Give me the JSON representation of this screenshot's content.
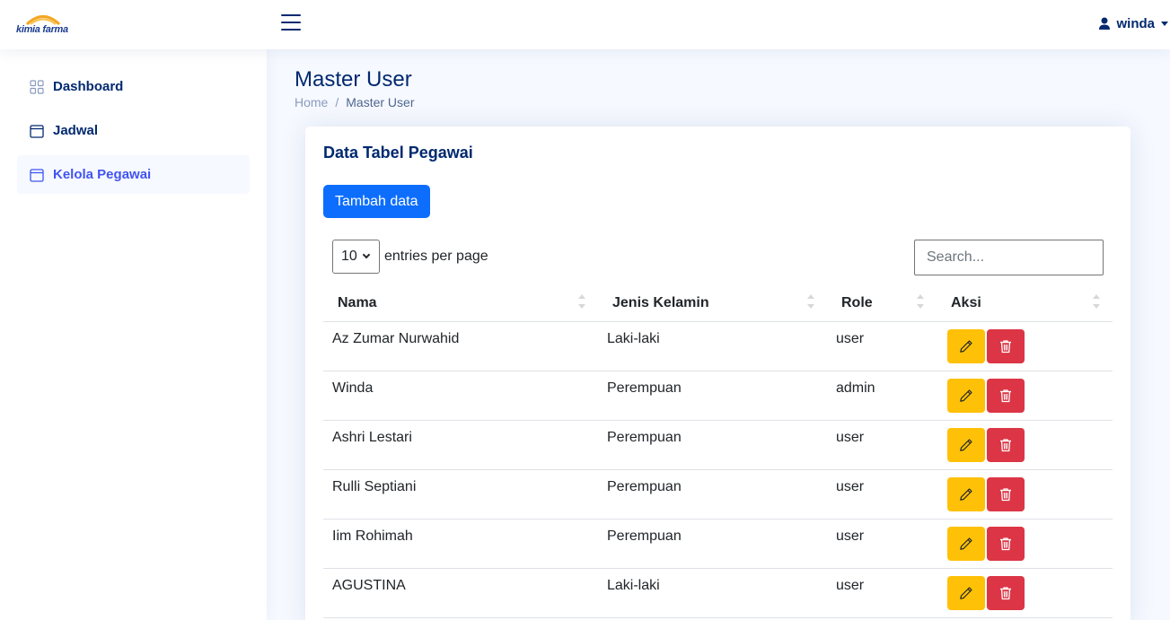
{
  "header": {
    "logo_text": "kimia farma",
    "user_name": "winda"
  },
  "sidebar": {
    "items": [
      {
        "label": "Dashboard",
        "icon": "grid-icon"
      },
      {
        "label": "Jadwal",
        "icon": "calendar-icon"
      },
      {
        "label": "Kelola Pegawai",
        "icon": "calendar-icon",
        "active": true
      }
    ]
  },
  "page": {
    "title": "Master User",
    "breadcrumb": [
      "Home",
      "Master User"
    ]
  },
  "card": {
    "title": "Data Tabel Pegawai",
    "add_button": "Tambah data",
    "per_page_value": "10",
    "per_page_label": "entries per page",
    "search_placeholder": "Search...",
    "columns": [
      "Nama",
      "Jenis Kelamin",
      "Role",
      "Aksi"
    ],
    "rows": [
      {
        "nama": "Az Zumar Nurwahid",
        "jk": "Laki-laki",
        "role": "user"
      },
      {
        "nama": "Winda",
        "jk": "Perempuan",
        "role": "admin"
      },
      {
        "nama": "Ashri Lestari",
        "jk": "Perempuan",
        "role": "user"
      },
      {
        "nama": "Rulli Septiani",
        "jk": "Perempuan",
        "role": "user"
      },
      {
        "nama": "Iim Rohimah",
        "jk": "Perempuan",
        "role": "user"
      },
      {
        "nama": "AGUSTINA",
        "jk": "Laki-laki",
        "role": "user"
      }
    ]
  },
  "colors": {
    "primary": "#0d6efd",
    "edit": "#ffc107",
    "delete": "#dc3545",
    "nav_active": "#4154f1",
    "text_dark": "#012970"
  }
}
